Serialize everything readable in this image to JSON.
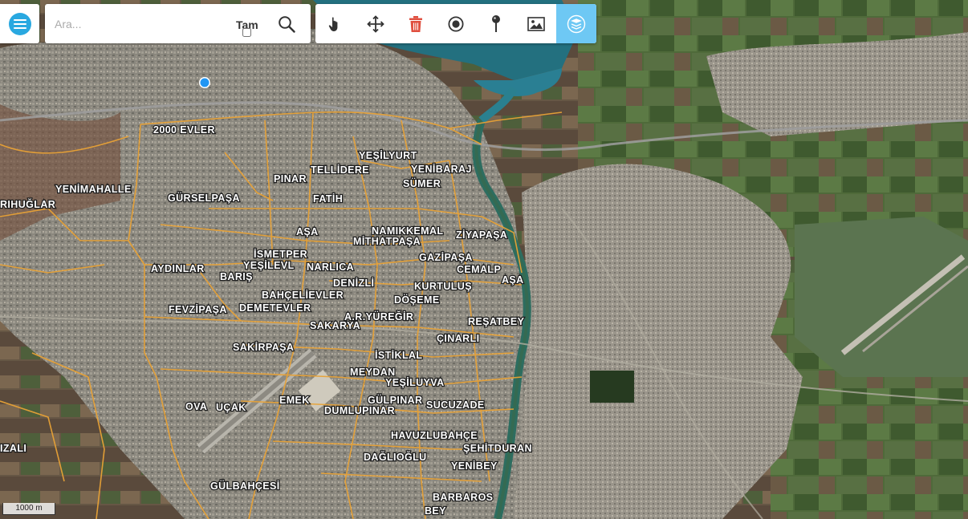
{
  "search": {
    "placeholder": "Ara...",
    "value": "",
    "tam_label": "Tam",
    "tam_checked": false
  },
  "toolbar": {
    "tools": [
      "hand-icon",
      "move-icon",
      "trash-icon",
      "circle-target-icon",
      "pin-icon",
      "image-icon",
      "layers-icon"
    ],
    "active_tool": "layers-icon"
  },
  "colors": {
    "accent": "#29a8e0",
    "active_tool": "#6ec8f4",
    "delete": "#e04f3f",
    "district_boundary": "#e8a236",
    "water": "#2a7f93",
    "location_dot": "#2196f3"
  },
  "scale_label": "1000 m",
  "map_labels": {
    "evler2000": "2000 EVLER",
    "yesilyurt": "YEŞİLYURT",
    "yenibaraj": "YENİBARAJ",
    "pinar": "PINAR",
    "tellidere": "TELLİDERE",
    "sumer": "SÜMER",
    "yenimahalle": "YENİMAHALLE",
    "fatih": "FATİH",
    "gurselpasa": "GÜRSELPAŞA",
    "rihuglar": "RIHUĞLAR",
    "asa1": "AŞA",
    "namikkemal": "NAMIKKEMAL",
    "ziyapasa": "ZİYAPAŞA",
    "mithatpasa": "MİTHATPAŞA",
    "ismetper": "İSMETPER",
    "gazipasa": "GAZİPAŞA",
    "aydinlar": "AYDINLAR",
    "yesilevl": "YEŞİLEVL",
    "narlica": "NARLICA",
    "cemalp": "CEMALP",
    "baris": "BARIŞ",
    "asa2": "AŞA",
    "denizli": "DENİZLİ",
    "kurtulus": "KURTULUŞ",
    "bahcelievler": "BAHÇELİEVLER",
    "doseme": "DÖŞEME",
    "fevzipasa": "FEVZİPAŞA",
    "demetevler": "DEMETEVLER",
    "aryuregir": "A.R.YÜREĞİR",
    "resatbey": "REŞATBEY",
    "sakarya": "SAKARYA",
    "cinarli": "ÇINARLI",
    "sakirpasa": "SAKİRPAŞA",
    "istiklal": "İSTİKLAL",
    "meydan": "MEYDAN",
    "yesiluyva": "YEŞİLUYVA",
    "emek": "EMEK",
    "gulpinar": "GÜLPINAR",
    "ova": "OVA",
    "ucak": "UÇAK",
    "sucuzade": "SUCUZADE",
    "dumlupinar": "DUMLUPINAR",
    "havuzlubahce": "HAVUZLUBAHÇE",
    "sehitduran": "ŞEHİTDURAN",
    "izali": "IZALI",
    "daglioglu": "DAĞLIOĞLU",
    "yenibey": "YENİBEY",
    "gulbahcesi": "GÜLBAHÇESİ",
    "barbaros": "BARBAROS",
    "bey": "BEY"
  }
}
